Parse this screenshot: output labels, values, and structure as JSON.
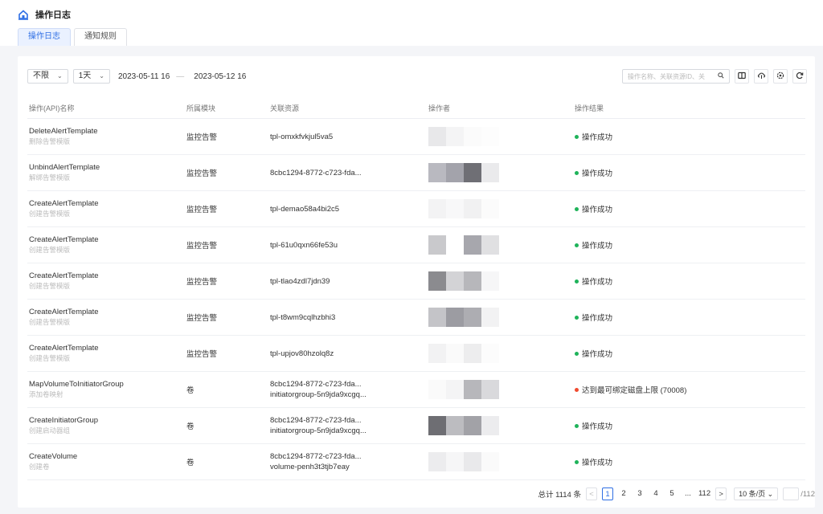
{
  "header": {
    "title": "操作日志"
  },
  "tabs": [
    {
      "label": "操作日志",
      "active": true
    },
    {
      "label": "通知规则",
      "active": false
    }
  ],
  "filters": {
    "scope": "不限",
    "range": "1天",
    "start": "2023-05-11 16",
    "separator": "—",
    "end": "2023-05-12 16"
  },
  "search": {
    "placeholder": "操作名称、关联资源ID、关"
  },
  "table": {
    "headers": [
      "操作(API)名称",
      "所属模块",
      "关联资源",
      "操作者",
      "操作结果"
    ],
    "rows": [
      {
        "api": "DeleteAlertTemplate",
        "api_cn": "删除告警模版",
        "module": "监控告警",
        "res1": "tpl-omxkfvkjul5va5",
        "res2": "",
        "result": "操作成功",
        "status": "success"
      },
      {
        "api": "UnbindAlertTemplate",
        "api_cn": "解绑告警模版",
        "module": "监控告警",
        "res1": "8cbc1294-8772-c723-fda...",
        "res2": "",
        "result": "操作成功",
        "status": "success"
      },
      {
        "api": "CreateAlertTemplate",
        "api_cn": "创建告警模版",
        "module": "监控告警",
        "res1": "tpl-demao58a4bi2c5",
        "res2": "",
        "result": "操作成功",
        "status": "success"
      },
      {
        "api": "CreateAlertTemplate",
        "api_cn": "创建告警模版",
        "module": "监控告警",
        "res1": "tpl-61u0qxn66fe53u",
        "res2": "",
        "result": "操作成功",
        "status": "success"
      },
      {
        "api": "CreateAlertTemplate",
        "api_cn": "创建告警模版",
        "module": "监控告警",
        "res1": "tpl-tlao4zdl7jdn39",
        "res2": "",
        "result": "操作成功",
        "status": "success"
      },
      {
        "api": "CreateAlertTemplate",
        "api_cn": "创建告警模版",
        "module": "监控告警",
        "res1": "tpl-t8wm9cqlhzbhi3",
        "res2": "",
        "result": "操作成功",
        "status": "success"
      },
      {
        "api": "CreateAlertTemplate",
        "api_cn": "创建告警模版",
        "module": "监控告警",
        "res1": "tpl-upjov80hzolq8z",
        "res2": "",
        "result": "操作成功",
        "status": "success"
      },
      {
        "api": "MapVolumeToInitiatorGroup",
        "api_cn": "添加卷映射",
        "module": "卷",
        "res1": "8cbc1294-8772-c723-fda...",
        "res2": "initiatorgroup-5n9jda9xcgq...",
        "result": "达到最可绑定磁盘上限 (70008)",
        "status": "error"
      },
      {
        "api": "CreateInitiatorGroup",
        "api_cn": "创建启动器组",
        "module": "卷",
        "res1": "8cbc1294-8772-c723-fda...",
        "res2": "initiatorgroup-5n9jda9xcgq...",
        "result": "操作成功",
        "status": "success"
      },
      {
        "api": "CreateVolume",
        "api_cn": "创建卷",
        "module": "卷",
        "res1": "8cbc1294-8772-c723-fda...",
        "res2": "volume-penh3t3tjb7eay",
        "result": "操作成功",
        "status": "success"
      }
    ]
  },
  "pagination": {
    "total": "总计 1114 条",
    "prev": "<",
    "pages": [
      "1",
      "2",
      "3",
      "4",
      "5",
      "...",
      "112"
    ],
    "current": "1",
    "next": ">",
    "page_size": "10 条/页",
    "total_pages": "/112"
  },
  "colors": {
    "accent": "#2f6fe4",
    "success": "#1fb35a",
    "error": "#f04a2f"
  },
  "icons": [
    "home-icon",
    "chevron-down-icon",
    "search-icon",
    "columns-icon",
    "cloud-download-icon",
    "settings-icon",
    "refresh-icon"
  ]
}
